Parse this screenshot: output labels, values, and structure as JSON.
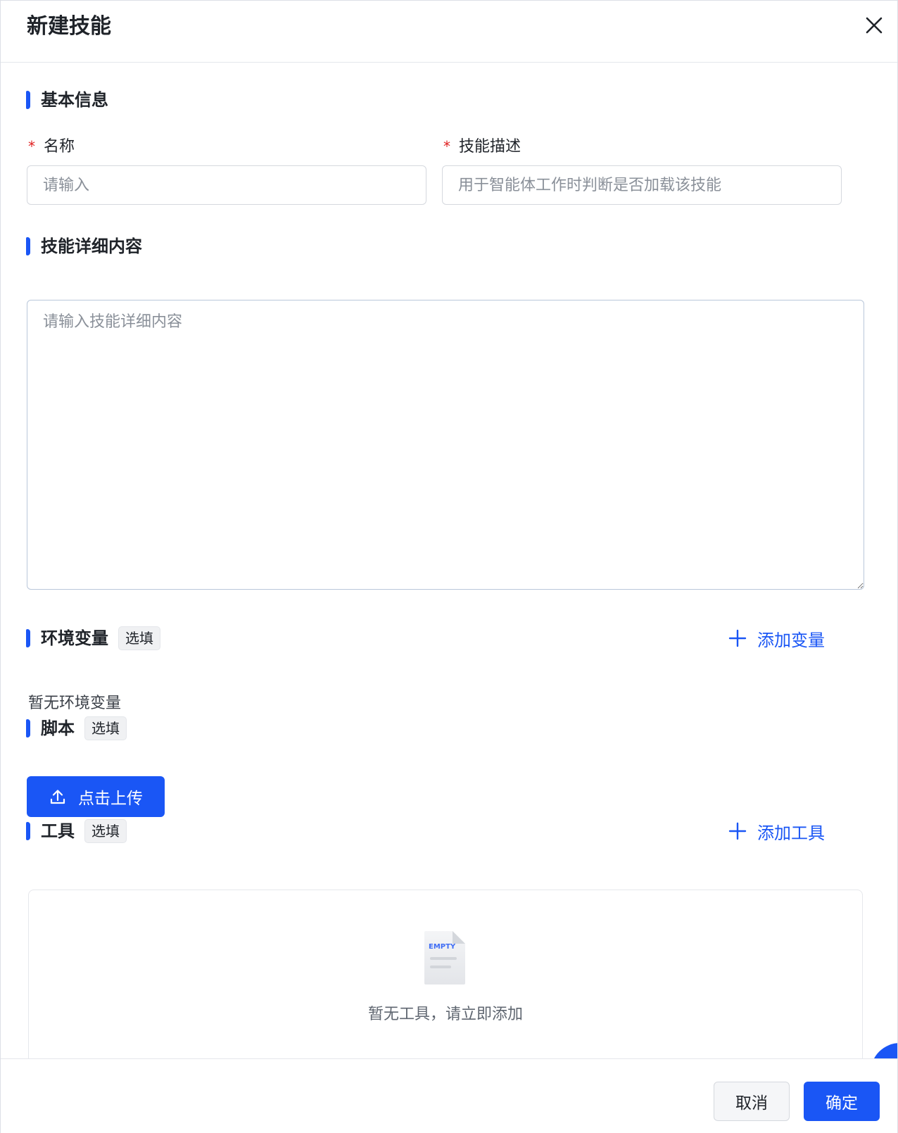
{
  "dialog": {
    "title": "新建技能",
    "close_icon": "close-icon"
  },
  "basic_info": {
    "section_title": "基本信息",
    "name": {
      "required_mark": "*",
      "label": "名称",
      "placeholder": "请输入",
      "value": ""
    },
    "description": {
      "required_mark": "*",
      "label": "技能描述",
      "placeholder": "用于智能体工作时判断是否加载该技能",
      "value": ""
    }
  },
  "detail": {
    "section_title": "技能详细内容",
    "placeholder": "请输入技能详细内容",
    "value": ""
  },
  "env_vars": {
    "section_title": "环境变量",
    "tag": "选填",
    "add_label": "添加变量",
    "empty_text": "暂无环境变量"
  },
  "script": {
    "section_title": "脚本",
    "tag": "选填",
    "upload_label": "点击上传"
  },
  "tools": {
    "section_title": "工具",
    "tag": "选填",
    "add_label": "添加工具",
    "empty_illustration_text": "EMPTY",
    "empty_text": "暂无工具，请立即添加"
  },
  "footer": {
    "cancel_label": "取消",
    "confirm_label": "确定"
  },
  "colors": {
    "primary": "#1a56f5",
    "required": "#e02020",
    "border": "#d5d8de"
  }
}
